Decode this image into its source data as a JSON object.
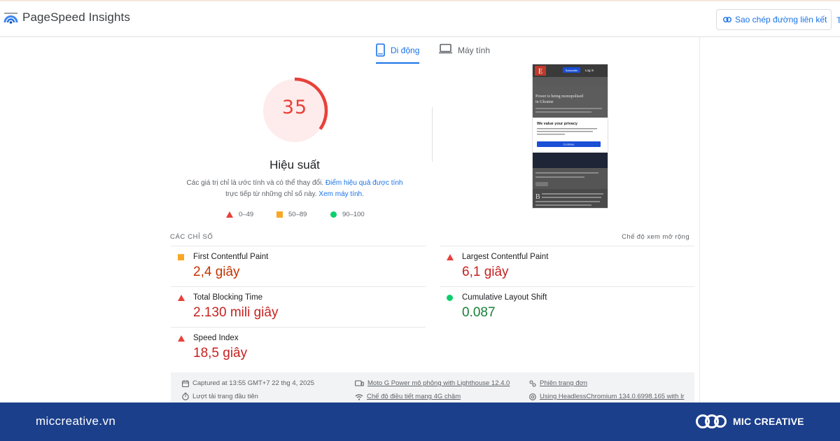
{
  "header": {
    "app_title": "PageSpeed Insights",
    "copy_link_label": "Sao chép đường liên kết",
    "truncated_label": "T"
  },
  "tabs": [
    {
      "label": "Di động",
      "icon": "smartphone-icon",
      "active": true
    },
    {
      "label": "Máy tính",
      "icon": "laptop-icon",
      "active": false
    }
  ],
  "score": {
    "value": "35",
    "fraction": 0.35,
    "title": "Hiệu suất",
    "desc_prefix": "Các giá trị chỉ là ước tính và có thể thay đổi.",
    "desc_link1": "Điểm hiệu quả được tính",
    "desc_mid": "trực tiếp từ những chỉ số này.",
    "desc_link2": "Xem máy tính."
  },
  "legend": [
    {
      "label": "0–49",
      "shape": "triangle",
      "color": "#e8413a"
    },
    {
      "label": "50–89",
      "shape": "square",
      "color": "#f9a825"
    },
    {
      "label": "90–100",
      "shape": "circle",
      "color": "#0cce6b"
    }
  ],
  "screenshot": {
    "btn_label": "Subscribe",
    "login": "Log in",
    "headline_line1": "Power is being monopolised",
    "headline_line2": "in Ukraine",
    "privacy_title": "We value your privacy",
    "continue": "Continue"
  },
  "metrics_section": {
    "label": "CÁC CHỈ SỐ",
    "expand_label": "Chế độ xem mở rộng"
  },
  "metrics": [
    {
      "name": "First Contentful Paint",
      "value": "2,4 giây",
      "status": "average"
    },
    {
      "name": "Largest Contentful Paint",
      "value": "6,1 giây",
      "status": "poor"
    },
    {
      "name": "Total Blocking Time",
      "value": "2.130 mili giây",
      "status": "poor"
    },
    {
      "name": "Cumulative Layout Shift",
      "value": "0.087",
      "status": "good"
    },
    {
      "name": "Speed Index",
      "value": "18,5 giây",
      "status": "poor"
    }
  ],
  "footer_info": [
    {
      "text": "Captured at 13:55 GMT+7 22 thg 4, 2025",
      "icon": "calendar-icon"
    },
    {
      "text": "Moto G Power mô phỏng with Lighthouse 12.4.0",
      "icon": "device-icon"
    },
    {
      "text": "Phiên trang đơn",
      "icon": "session-icon"
    },
    {
      "text": "Lượt tải trang đầu tiên",
      "icon": "timer-icon"
    },
    {
      "text": "Chế độ điều tiết mạng 4G chậm",
      "icon": "wifi-icon"
    },
    {
      "text": "Using HeadlessChromium 134.0.6998.165 with lr",
      "icon": "chrome-icon"
    }
  ],
  "banner": {
    "website": "miccreative.vn",
    "brand": "MIC CREATIVE"
  }
}
